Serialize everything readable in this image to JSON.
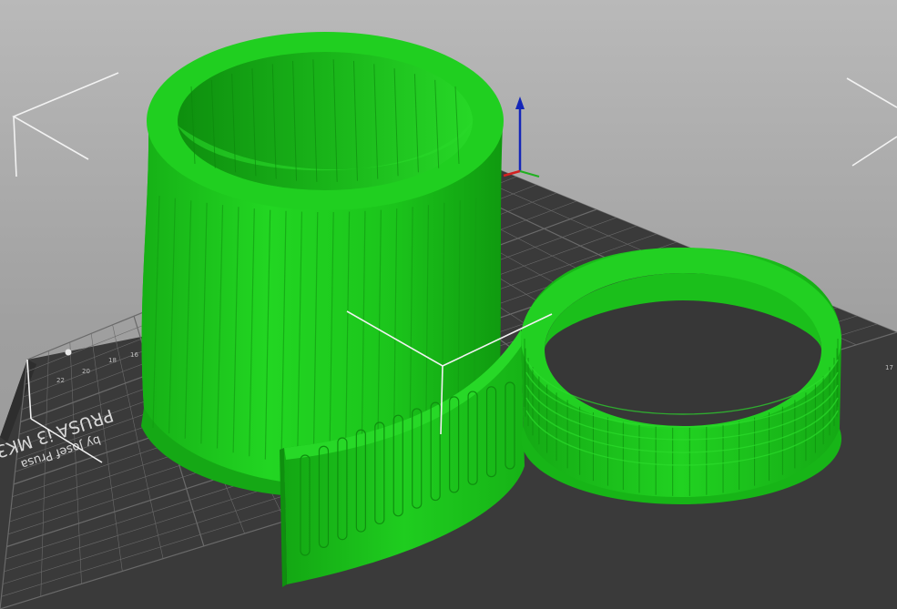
{
  "viewport": {
    "background_top": "#b9b9b9",
    "background_bottom": "#979797"
  },
  "bed": {
    "surface_color": "#3b3b3b",
    "grid_color": "#6a6a6a",
    "label_line1": "PRUSA i3 MK3",
    "label_line2": "by Josef Prusa",
    "x_ticks": [
      "16",
      "18",
      "20",
      "22"
    ],
    "y_ticks": [
      "17"
    ]
  },
  "models": [
    {
      "name": "tapered-cup-shell",
      "color": "#1fc81f"
    },
    {
      "name": "curved-strip-panel",
      "color": "#1fc81f"
    },
    {
      "name": "ring-band",
      "color": "#1fc81f"
    }
  ],
  "icons": [
    "axes-gizmo-icon",
    "selection-bracket-icon"
  ]
}
